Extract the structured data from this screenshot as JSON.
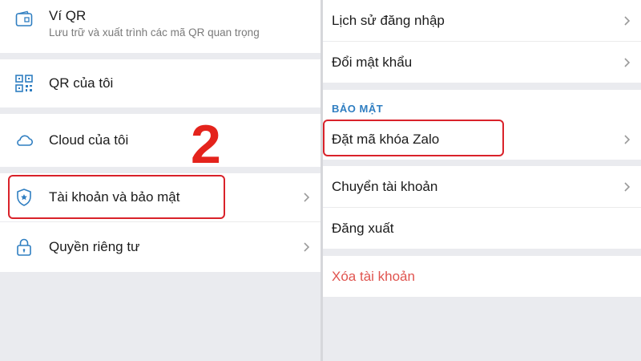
{
  "left": {
    "vi_qr": {
      "title": "Ví QR",
      "subtitle": "Lưu trữ và xuất trình các mã QR quan trọng"
    },
    "items": [
      {
        "label": "QR của tôi",
        "icon": "qr-code-icon"
      },
      {
        "label": "Cloud của tôi",
        "icon": "cloud-icon"
      },
      {
        "label": "Tài khoản và bảo mật",
        "icon": "shield-icon"
      },
      {
        "label": "Quyền riêng tư",
        "icon": "lock-icon"
      }
    ],
    "step_number": "2"
  },
  "right": {
    "items_top": [
      {
        "label": "Lịch sử đăng nhập"
      },
      {
        "label": "Đổi mật khẩu"
      }
    ],
    "section_title": "BẢO MẬT",
    "items_security": [
      {
        "label": "Đặt mã khóa Zalo"
      },
      {
        "label": "Chuyển tài khoản"
      },
      {
        "label": "Đăng xuất"
      }
    ],
    "delete_account": "Xóa tài khoản"
  },
  "colors": {
    "highlight": "#d9222a",
    "section_title": "#2f7ec1",
    "delete": "#e0544f",
    "icon": "#2f7ec1"
  }
}
